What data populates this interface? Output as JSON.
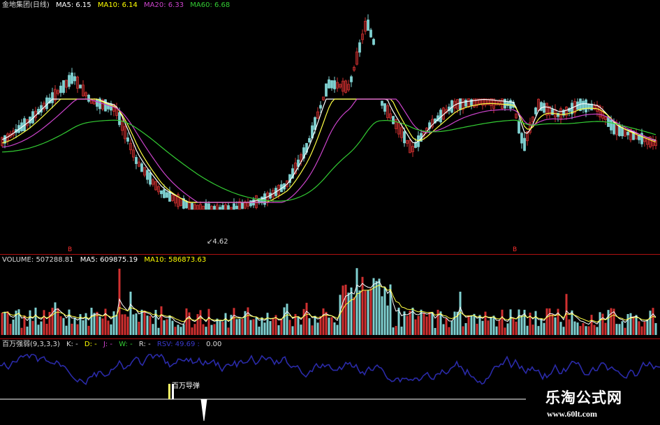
{
  "price_panel": {
    "stock_name": "金地集团(日线)",
    "ma5": {
      "label": "MA5:",
      "value": "6.15",
      "color": "#ffffff"
    },
    "ma10": {
      "label": "MA10:",
      "value": "6.14",
      "color": "#ffff00"
    },
    "ma20": {
      "label": "MA20:",
      "value": "6.33",
      "color": "#cc44cc"
    },
    "ma60": {
      "label": "MA60:",
      "value": "6.68",
      "color": "#33cc33"
    },
    "low_annotation": "4.62",
    "marker_left": "B",
    "marker_right": "B"
  },
  "volume_panel": {
    "volume": {
      "label": "VOLUME:",
      "value": "507288.81"
    },
    "ma5": {
      "label": "MA5:",
      "value": "609875.19"
    },
    "ma10": {
      "label": "MA10:",
      "value": "586873.63"
    }
  },
  "indicator_panel": {
    "name": "百万强弱(9,3,3,3)",
    "k": "K: -",
    "d": "D: -",
    "j": "J: -",
    "w": "W: -",
    "r": "R: -",
    "rsv": "RSV: 49.69 :",
    "last": "0.00",
    "signal_label": "百万导弹"
  },
  "watermark": {
    "title": "乐淘公式网",
    "url": "www.60lt.com"
  },
  "colors": {
    "background": "#000000",
    "up_candle": "#d03030",
    "down_candle": "#7fd0d0",
    "separator": "#b01010",
    "indicator_line": "#2a2aa8"
  }
}
